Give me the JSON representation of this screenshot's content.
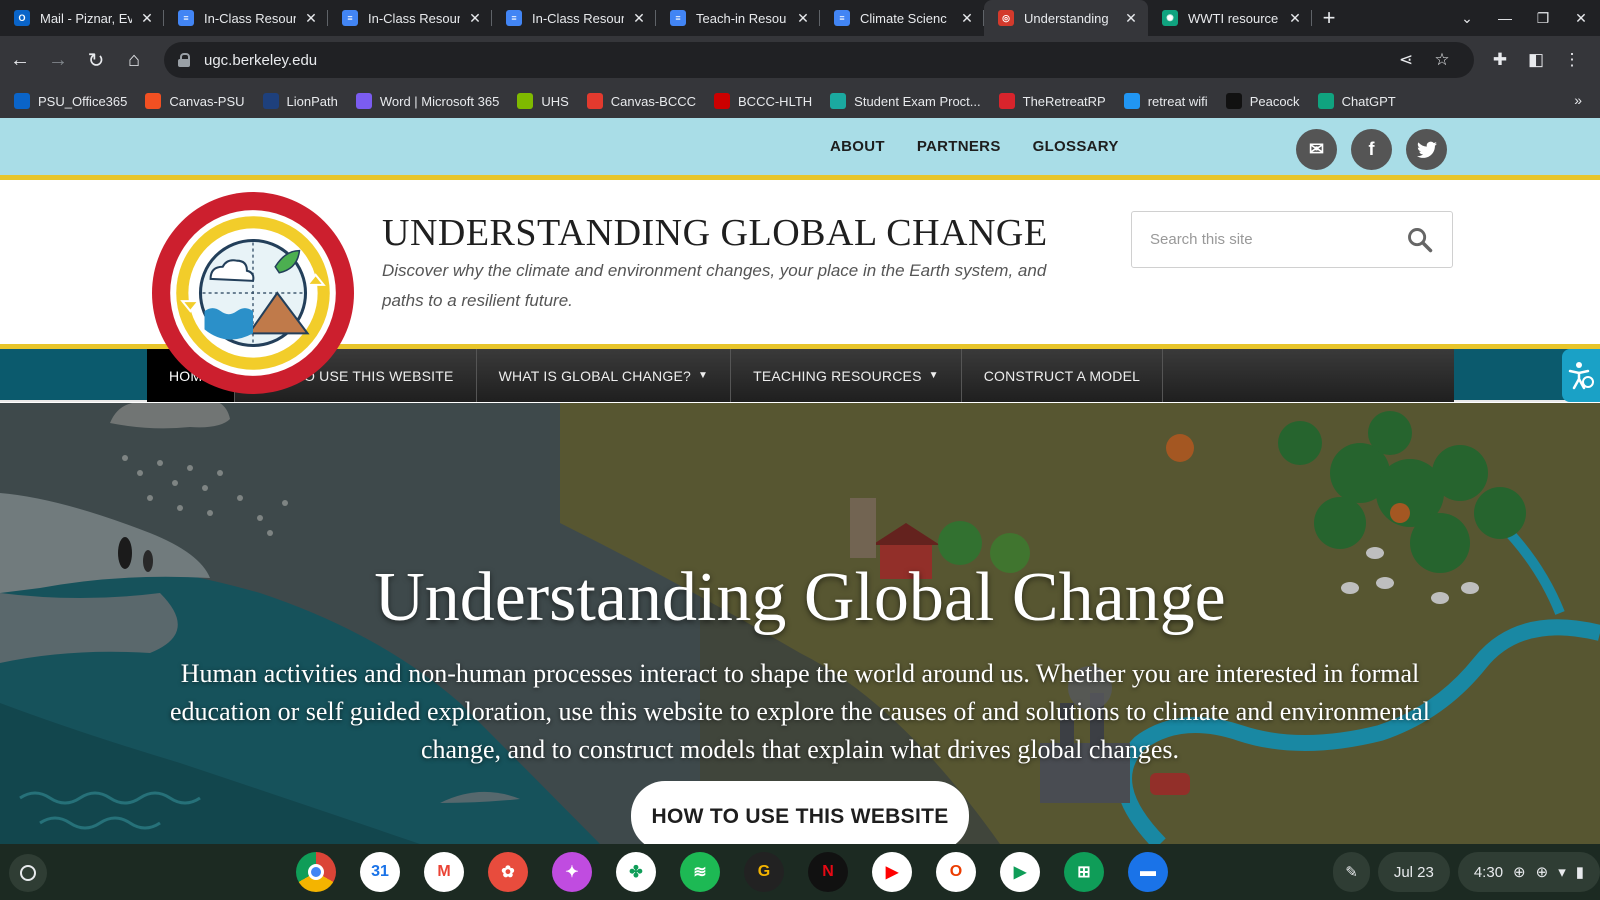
{
  "browser": {
    "tabs": [
      {
        "title": "Mail - Piznar, Ev",
        "color": "#0a64c8",
        "glyph": "O"
      },
      {
        "title": "In-Class Resour",
        "color": "#4285f4",
        "glyph": "≡"
      },
      {
        "title": "In-Class Resour",
        "color": "#4285f4",
        "glyph": "≡"
      },
      {
        "title": "In-Class Resour",
        "color": "#4285f4",
        "glyph": "≡"
      },
      {
        "title": "Teach-in Resou",
        "color": "#4285f4",
        "glyph": "≡"
      },
      {
        "title": "Climate Scienc",
        "color": "#4285f4",
        "glyph": "≡"
      },
      {
        "title": "Understanding",
        "color": "#d33a2c",
        "glyph": "◎"
      },
      {
        "title": "WWTI resource",
        "color": "#10a37f",
        "glyph": "✺"
      }
    ],
    "url": "ugc.berkeley.edu",
    "bookmarks": [
      {
        "label": "PSU_Office365",
        "color": "#0a64c8"
      },
      {
        "label": "Canvas-PSU",
        "color": "#f25022"
      },
      {
        "label": "LionPath",
        "color": "#1e407c"
      },
      {
        "label": "Word | Microsoft 365",
        "color": "#7b5cf0"
      },
      {
        "label": "UHS",
        "color": "#7fba00"
      },
      {
        "label": "Canvas-BCCC",
        "color": "#e23a2e"
      },
      {
        "label": "BCCC-HLTH",
        "color": "#cc0000"
      },
      {
        "label": "Student Exam Proct...",
        "color": "#1ba9a0"
      },
      {
        "label": "TheRetreatRP",
        "color": "#d8242c"
      },
      {
        "label": "retreat wifi",
        "color": "#2196f3"
      },
      {
        "label": "Peacock",
        "color": "#111111"
      },
      {
        "label": "ChatGPT",
        "color": "#10a37f"
      }
    ]
  },
  "site": {
    "topnav": [
      "ABOUT",
      "PARTNERS",
      "GLOSSARY"
    ],
    "title": "UNDERSTANDING GLOBAL CHANGE",
    "tagline": "Discover why the climate and environment changes, your place in the Earth system, and paths to a resilient future.",
    "search_placeholder": "Search this site",
    "mainnav": [
      {
        "label": "HOME",
        "active": true,
        "dropdown": false
      },
      {
        "label": "HOW TO USE THIS WEBSITE",
        "active": false,
        "dropdown": false
      },
      {
        "label": "WHAT IS GLOBAL CHANGE?",
        "active": false,
        "dropdown": true
      },
      {
        "label": "TEACHING RESOURCES",
        "active": false,
        "dropdown": true
      },
      {
        "label": "CONSTRUCT A MODEL",
        "active": false,
        "dropdown": false
      }
    ],
    "hero": {
      "title": "Understanding Global Change",
      "text": "Human activities and non-human processes interact to shape the world around us. Whether you are interested in formal education or self guided exploration, use this website to explore the causes of and solutions to climate and environmental change, and to construct models that explain what drives global changes.",
      "button": "HOW TO USE THIS WEBSITE"
    },
    "colors": {
      "band": "#a9dde7",
      "gold": "#e8c52a",
      "nav": "#0b5a6d",
      "logo_red": "#cc1f2e"
    }
  },
  "shelf": {
    "apps": [
      {
        "name": "chrome",
        "color": "#ffffff",
        "glyph": ""
      },
      {
        "name": "calendar",
        "color": "#ffffff",
        "glyph": "31"
      },
      {
        "name": "gmail",
        "color": "#ffffff",
        "glyph": "M"
      },
      {
        "name": "canvas",
        "color": "#e84c3d",
        "glyph": "✿"
      },
      {
        "name": "screencast",
        "color": "#c04ce0",
        "glyph": "✦"
      },
      {
        "name": "photos",
        "color": "#ffffff",
        "glyph": "✤"
      },
      {
        "name": "spotify",
        "color": "#1db954",
        "glyph": "≋"
      },
      {
        "name": "goodnotes",
        "color": "#222222",
        "glyph": "G"
      },
      {
        "name": "netflix",
        "color": "#111111",
        "glyph": "N"
      },
      {
        "name": "youtube",
        "color": "#ffffff",
        "glyph": "▶"
      },
      {
        "name": "office",
        "color": "#ffffff",
        "glyph": "O"
      },
      {
        "name": "play-store",
        "color": "#ffffff",
        "glyph": "▶"
      },
      {
        "name": "sheets",
        "color": "#0f9d58",
        "glyph": "⊞"
      },
      {
        "name": "files",
        "color": "#1a73e8",
        "glyph": "▬"
      }
    ],
    "date": "Jul 23",
    "time": "4:30"
  }
}
